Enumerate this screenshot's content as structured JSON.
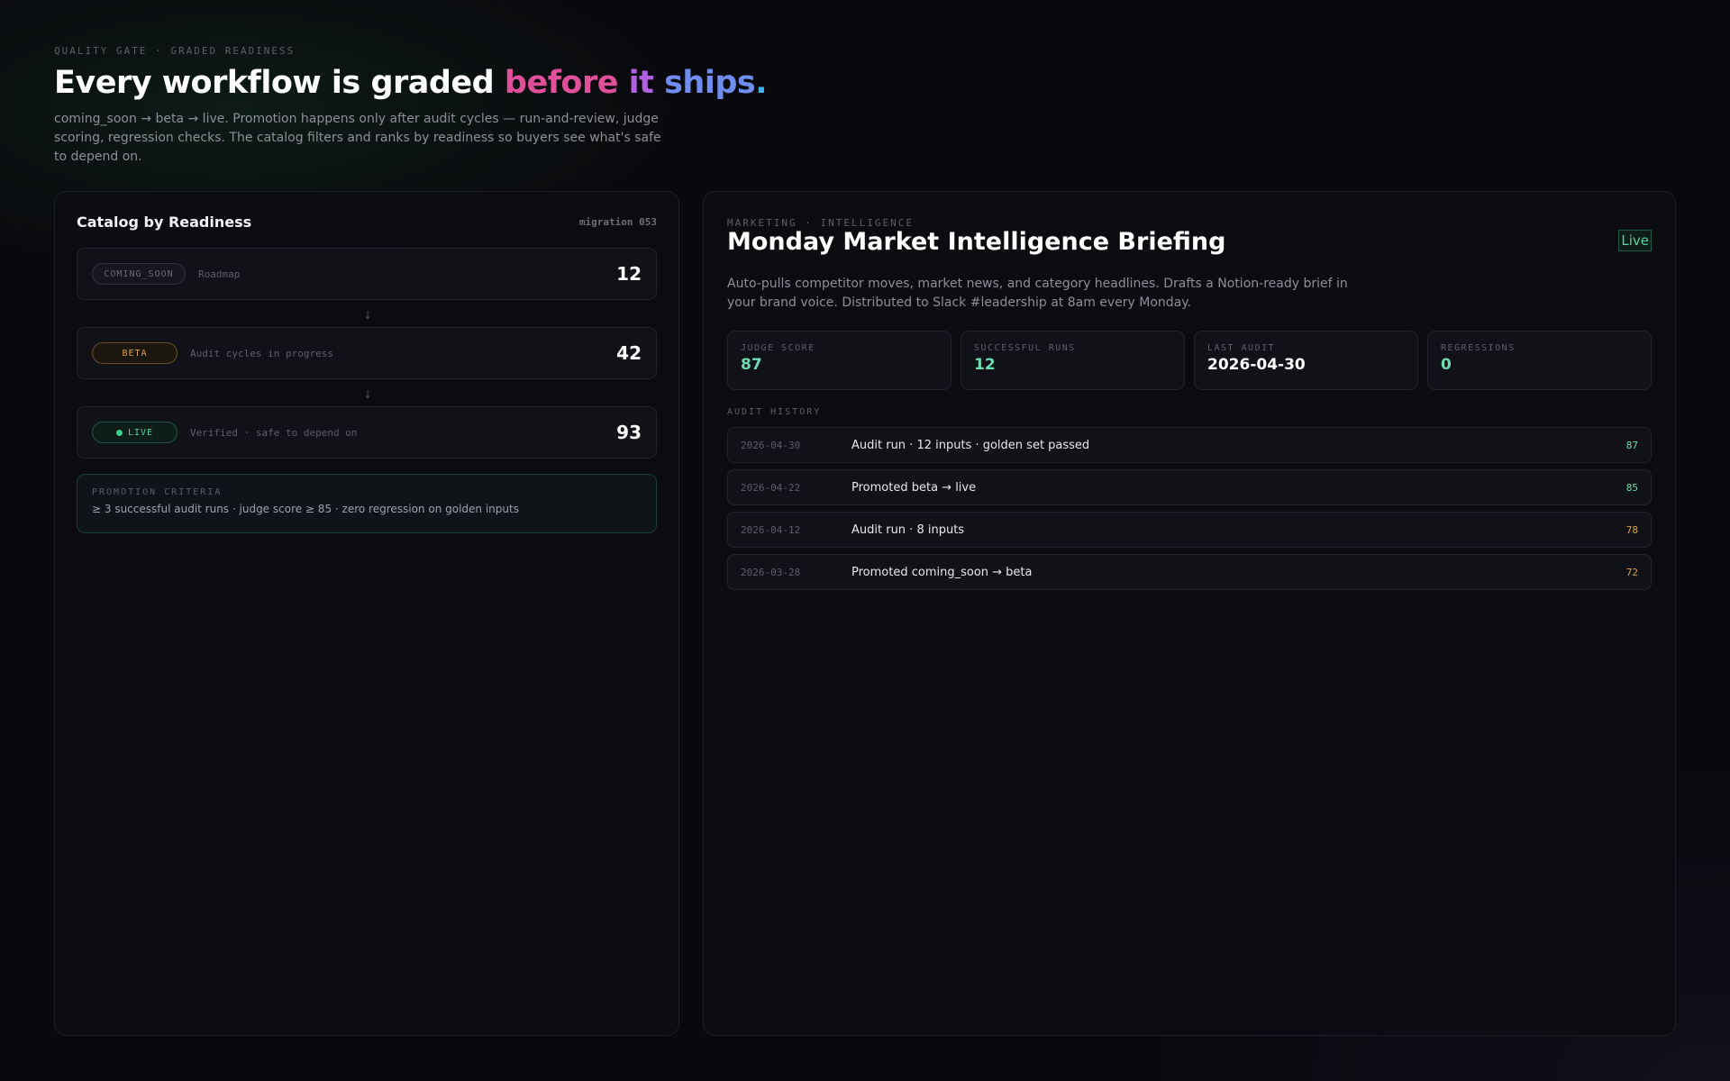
{
  "hero": {
    "eyebrow": "QUALITY GATE · GRADED READINESS",
    "headline_plain": "Every workflow is graded ",
    "headline_before": "before",
    "headline_it": "it",
    "headline_ships": "ships",
    "headline_dot": ".",
    "subtitle": "coming_soon → beta → live. Promotion happens only after audit cycles — run-and-review, judge scoring, regression checks. The catalog filters and ranks by readiness so buyers see what's safe to depend on."
  },
  "catalog": {
    "title": "Catalog by Readiness",
    "migration": "migration 053",
    "arrow": "↓",
    "stages": [
      {
        "pill": "COMING_SOON",
        "desc": "Roadmap",
        "count": "12"
      },
      {
        "pill": "BETA",
        "desc": "Audit cycles in progress",
        "count": "42"
      },
      {
        "pill": "LIVE",
        "desc": "Verified · safe to depend on",
        "count": "93"
      }
    ],
    "criteria": {
      "label": "PROMOTION CRITERIA",
      "text": "≥ 3 successful audit runs · judge score ≥ 85 · zero regression on golden inputs"
    }
  },
  "detail": {
    "eyebrow": "MARKETING · INTELLIGENCE",
    "title": "Monday Market Intelligence Briefing",
    "status": "Live",
    "description": "Auto-pulls competitor moves, market news, and category headlines. Drafts a Notion-ready brief in your brand voice. Distributed to Slack #leadership at 8am every Monday.",
    "stats": [
      {
        "label": "JUDGE SCORE",
        "value": "87"
      },
      {
        "label": "SUCCESSFUL RUNS",
        "value": "12"
      },
      {
        "label": "LAST AUDIT",
        "value": "2026-04-30"
      },
      {
        "label": "REGRESSIONS",
        "value": "0"
      }
    ],
    "history_label": "AUDIT HISTORY",
    "history": [
      {
        "date": "2026-04-30",
        "text": "Audit run · 12 inputs · golden set passed",
        "score": "87"
      },
      {
        "date": "2026-04-22",
        "text": "Promoted beta → live",
        "score": "85"
      },
      {
        "date": "2026-04-12",
        "text": "Audit run · 8 inputs",
        "score": "78"
      },
      {
        "date": "2026-03-28",
        "text": "Promoted coming_soon → beta",
        "score": "72"
      }
    ]
  },
  "colors": {
    "accent_green": "#58d0a0",
    "accent_amber": "#d8a24a",
    "gradient_pink": "#e0509a",
    "gradient_purple": "#b060e0",
    "gradient_blue": "#6f8cf0"
  }
}
